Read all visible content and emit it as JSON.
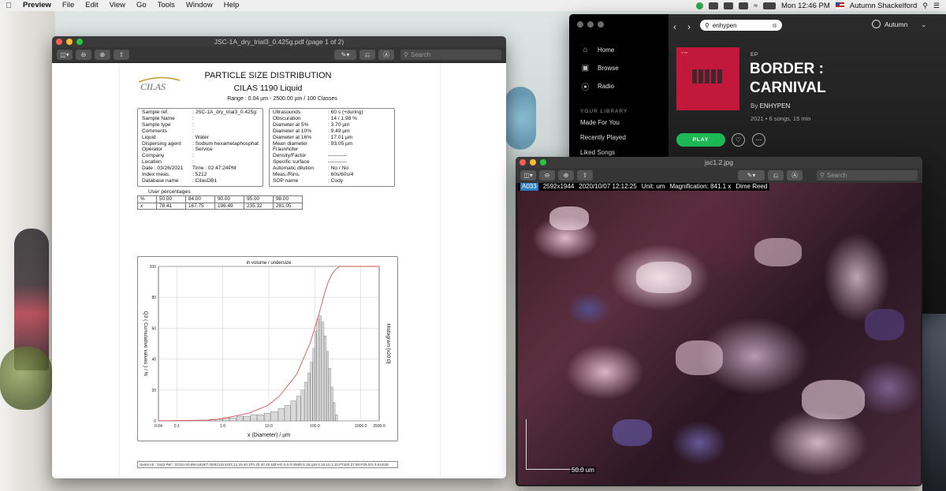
{
  "menubar": {
    "app_name": "Preview",
    "items": [
      "File",
      "Edit",
      "View",
      "Go",
      "Tools",
      "Window",
      "Help"
    ],
    "clock": "Mon 12:46 PM",
    "user": "Autumn Shackelford"
  },
  "pdf_window": {
    "title": "JSC-1A_dry_trial3_0.425g.pdf (page 1 of 2)",
    "search_placeholder": "Search",
    "report": {
      "logo_text": "CILAS",
      "title": "PARTICLE SIZE DISTRIBUTION",
      "subtitle": "CILAS 1190 Liquid",
      "range": "Range :    0.04 µm -  2500.00 µm / 100 Classes",
      "left_fields": [
        {
          "k": "Sample ref.",
          "v": ": JSC-1A_dry_trial3_0.425g"
        },
        {
          "k": "Sample Name",
          "v": ":"
        },
        {
          "k": "Sample type",
          "v": ":"
        },
        {
          "k": "Comments",
          "v": ":"
        },
        {
          "k": "Liquid",
          "v": ": Water"
        },
        {
          "k": "Dispersing agent",
          "v": ": Sodium hexametaphosphat"
        },
        {
          "k": "Operator",
          "v": ": Service"
        },
        {
          "k": "Company",
          "v": ":"
        },
        {
          "k": "Location",
          "v": ":"
        },
        {
          "k": "Date :  03/26/2021",
          "v": "Time :  02:47:24PM"
        },
        {
          "k": "Index meas.",
          "v": ": 5212"
        },
        {
          "k": "Database name",
          "v": ": CilasDB1"
        }
      ],
      "right_fields": [
        {
          "k": "Ultrasounds",
          "v": ": 60        s (+during)"
        },
        {
          "k": "Obscuration",
          "v": ": 14 / 1.98 %"
        },
        {
          "k": "Diameter at 5%",
          "v": ":   3.70      µm"
        },
        {
          "k": "Diameter at 10%",
          "v": ":   9.49      µm"
        },
        {
          "k": "Diameter at 16%",
          "v": ":   17.01    µm"
        },
        {
          "k": "Mean diameter",
          "v": ":   93.05    µm"
        },
        {
          "k": "Fraunhofer",
          "v": ""
        },
        {
          "k": "Density/Factor",
          "v": "  -----------"
        },
        {
          "k": "Specific surface",
          "v": "  -----------"
        },
        {
          "k": "Automatic dilution",
          "v": ": No / No"
        },
        {
          "k": "Meas./Rins.",
          "v": ": 60s/60s/4"
        },
        {
          "k": "SOP name",
          "v": ": Cody"
        }
      ],
      "user_percentages_label": "User percentages",
      "pct_row": [
        "%",
        "50.00",
        "84.00",
        "90.00",
        "95.00",
        "98.00"
      ],
      "x_row": [
        "x",
        "78.41",
        "167.75",
        "196.49",
        "235.32",
        "281.05"
      ],
      "serial": "Serial nb : 3442     Ref :  2/315.m0.88A1818/7.00/5212/m103.12.20.40.1Fh.20.20.40.1BhVG-0.0.0.0/600.0.15.g10.0.16.10.1.10.P7200.27.80.P29.0/V 9.51/635"
    }
  },
  "chart_data": {
    "type": "bar",
    "title": "in volume / undersize",
    "xlabel": "x (Diameter) / µm",
    "ylabel": "Q3 ( Cumulative values ) / %",
    "y2label": "Histogram [x20.0]",
    "x_scale": "log",
    "xlim": [
      0.04,
      2500.0
    ],
    "ylim": [
      0,
      100
    ],
    "x_tick_labels": [
      "0.04",
      "0.1",
      "1.0",
      "10.0",
      "100.0",
      "1000.0",
      "2500.0"
    ],
    "y_tick_labels": [
      "0",
      "20",
      "40",
      "60",
      "80",
      "100"
    ],
    "grid": true,
    "series": [
      {
        "kind": "histogram",
        "x": [
          0.5,
          0.7,
          1.0,
          1.4,
          2.0,
          2.8,
          4.0,
          5.6,
          8.0,
          11.0,
          16.0,
          22.0,
          30.0,
          40.0,
          50.0,
          60.0,
          70.0,
          80.0,
          90.0,
          100.0,
          110.0,
          125.0,
          140.0,
          160.0,
          180.0,
          200.0,
          225.0,
          250.0,
          280.0
        ],
        "values": [
          1,
          1,
          2,
          2,
          3,
          3,
          4,
          4,
          5,
          6,
          8,
          10,
          13,
          16,
          20,
          25,
          31,
          38,
          47,
          58,
          66,
          68,
          64,
          55,
          45,
          34,
          22,
          12,
          4
        ]
      },
      {
        "kind": "cumulative",
        "x": [
          0.04,
          0.5,
          1.0,
          3.7,
          9.49,
          17.01,
          40.0,
          78.41,
          120.0,
          167.75,
          196.49,
          235.32,
          281.05,
          350.0,
          2500.0
        ],
        "values": [
          0,
          0.5,
          1.5,
          5,
          10,
          16,
          30,
          50,
          68,
          84,
          90,
          95,
          98,
          100,
          100
        ]
      }
    ]
  },
  "spotify": {
    "search_value": "enhypen",
    "user": "Autumn",
    "nav": [
      "Home",
      "Browse",
      "Radio"
    ],
    "library_header": "YOUR LIBRARY",
    "library": [
      "Made For You",
      "Recently Played",
      "Liked Songs"
    ],
    "album_type": "EP",
    "album_title": "BORDER : CARNIVAL",
    "by_label": "By",
    "artist": "ENHYPEN",
    "meta": "2021 • 6 songs, 15 min",
    "play_label": "PLAY",
    "accent": "#1db954"
  },
  "image_window": {
    "title": "jsc1.2.jpg",
    "search_placeholder": "Search",
    "overlay": [
      "A033",
      "2592x1944",
      "2020/10/07 12:12:25",
      "Unit: um",
      "Magnification: 841.1 x",
      "Dime Reed"
    ],
    "scale_label": "50.0 um"
  }
}
